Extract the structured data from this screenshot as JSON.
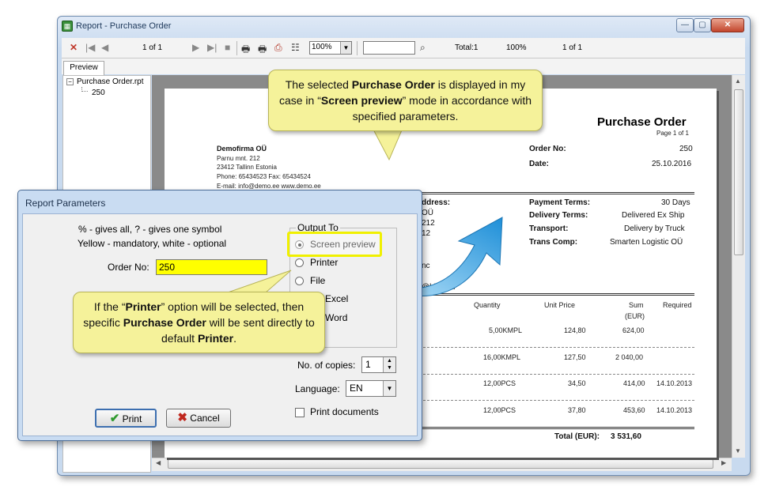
{
  "window": {
    "title": "Report - Purchase Order",
    "controls": {
      "minimize": "—",
      "maximize": "▢",
      "close": "✕"
    }
  },
  "toolbar": {
    "page_of": "1 of 1",
    "zoom": "100%",
    "search_value": "",
    "total": "Total:1",
    "percent": "100%",
    "page_of_2": "1 of 1"
  },
  "tabs": {
    "preview": "Preview"
  },
  "tree": {
    "root": "Purchase Order.rpt",
    "child": "250"
  },
  "report": {
    "title": "Purchase Order",
    "page": "Page 1 of 1",
    "company": {
      "name": "Demofirma OÜ",
      "address1": "Parnu mnt. 212",
      "address2": "23412 Tallinn Estonia",
      "phone": "Phone: 65434523   Fax: 65434524",
      "email": "E-mail: info@demo.ee      www.demo.ee"
    },
    "order_no_label": "Order No:",
    "order_no": "250",
    "date_label": "Date:",
    "date": "25.10.2016",
    "address_label": "ddress:",
    "address_lines": [
      "OÜ",
      "212",
      "12"
    ],
    "address_extra": "nc",
    "email_fragment": "@bike.eu",
    "terms": [
      {
        "label": "Payment Terms:",
        "value": "30 Days"
      },
      {
        "label": "Delivery Terms:",
        "value": "Delivered Ex Ship"
      },
      {
        "label": "Transport:",
        "value": "Delivery by Truck"
      },
      {
        "label": "Trans Comp:",
        "value": "Smarten Logistic OÜ"
      }
    ],
    "columns": {
      "quantity": "Quantity",
      "unit_price": "Unit Price",
      "sum": "Sum",
      "sum_unit": "(EUR)",
      "required": "Required"
    },
    "rows": [
      {
        "quantity": "5,00KMPL",
        "unit_price": "124,80",
        "sum": "624,00",
        "required": ""
      },
      {
        "quantity": "16,00KMPL",
        "unit_price": "127,50",
        "sum": "2 040,00",
        "required": ""
      },
      {
        "quantity": "12,00PCS",
        "unit_price": "34,50",
        "sum": "414,00",
        "required": "14.10.2013"
      },
      {
        "quantity": "12,00PCS",
        "unit_price": "37,80",
        "sum": "453,60",
        "required": "14.10.2013"
      }
    ],
    "total_label": "Total (EUR):",
    "total_value": "3 531,60"
  },
  "dialog": {
    "title": "Report Parameters",
    "hint1": "% - gives all, ? - gives one symbol",
    "hint2": "Yellow - mandatory, white - optional",
    "order_no_label": "Order No:",
    "order_no_value": "250",
    "output_group": "Output To",
    "options": [
      "Screen preview",
      "Printer",
      "File",
      "Excel",
      "Word"
    ],
    "copies_label": "No. of copies:",
    "copies_value": "1",
    "language_label": "Language:",
    "language_value": "EN",
    "print_documents": "Print documents",
    "print_button": "Print",
    "cancel_button": "Cancel"
  },
  "callouts": {
    "top": {
      "p1": "The selected ",
      "b1": "Purchase Order",
      "p2": " is displayed in my case in “",
      "b2": "Screen preview",
      "p3": "” mode in accordance with specified parameters."
    },
    "bottom": {
      "p1": "If the “",
      "b1": "Printer",
      "p2": "” option will be selected, then specific ",
      "b2": "Purchase Order",
      "p3": " will be sent directly to default ",
      "b3": "Printer",
      "p4": "."
    }
  },
  "colors": {
    "mandatory_field": "#ffff00",
    "callout": "#f5f29a",
    "arrow": "#2a9ee0"
  }
}
